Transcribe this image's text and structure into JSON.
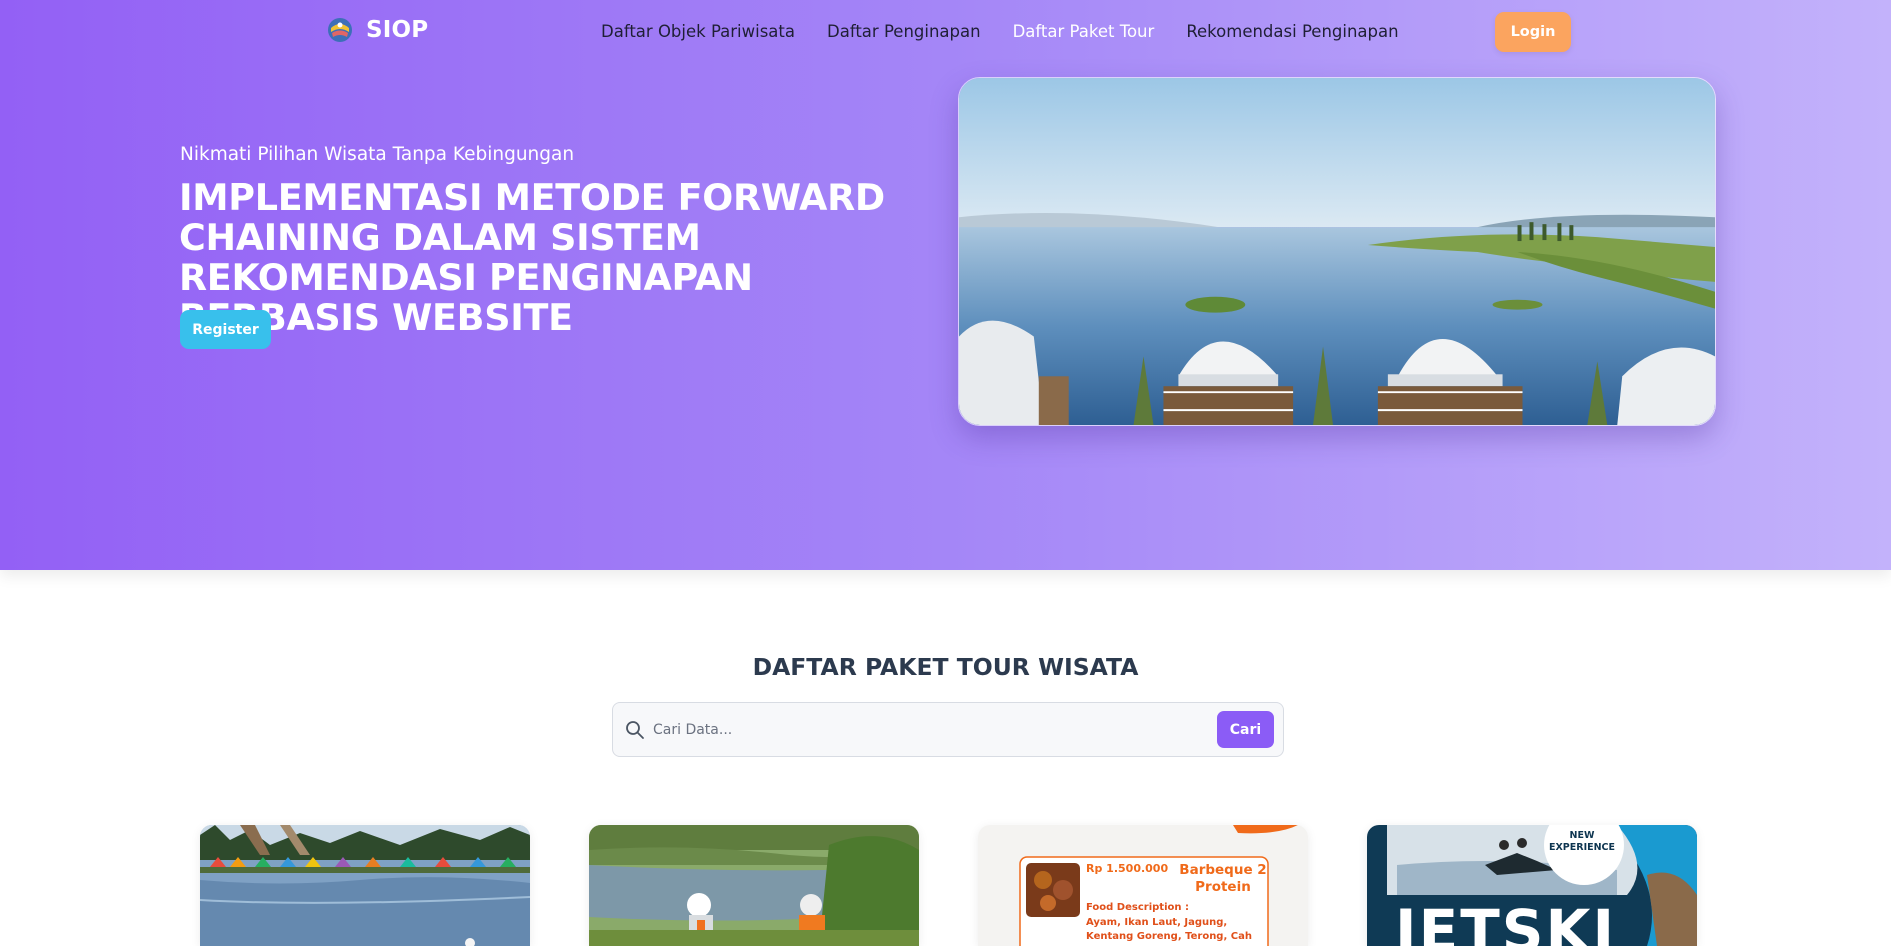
{
  "navbar": {
    "brand": "SIOP",
    "links": [
      {
        "label": "Daftar Objek Pariwisata",
        "active": false
      },
      {
        "label": "Daftar Penginapan",
        "active": false
      },
      {
        "label": "Daftar Paket Tour",
        "active": true
      },
      {
        "label": "Rekomendasi Penginapan",
        "active": false
      }
    ],
    "login_label": "Login"
  },
  "hero": {
    "subtitle": "Nikmati Pilihan Wisata Tanpa Kebingungan",
    "title": "IMPLEMENTASI METODE FORWARD CHAINING DALAM SISTEM REKOMENDASI PENGINAPAN BERBASIS WEBSITE",
    "register_label": "Register"
  },
  "section": {
    "title": "DAFTAR PAKET TOUR WISATA",
    "search_placeholder": "Cari Data...",
    "search_value": "",
    "search_button": "Cari"
  },
  "cards": [
    {
      "image": "lake-camping-tents"
    },
    {
      "image": "cycling-by-lake"
    },
    {
      "image": "barbeque-poster",
      "price": "Rp 1.500.000",
      "title": "Barbeque 2 Protein",
      "desc_label": "Food Description :",
      "desc": "Ayam, Ikan Laut, Jagung, Kentang Goreng, Terong, Cah"
    },
    {
      "image": "jetski-poster",
      "badge": "NEW EXPERIENCE",
      "headline": "JETSKI"
    }
  ],
  "colors": {
    "hero_gradient_start": "#9360f5",
    "hero_gradient_end": "#c3b2fb",
    "login_button": "#fba45f",
    "register_button": "#38c0ec",
    "search_button": "#8b5cf6",
    "section_title": "#2c3a4e"
  },
  "icons": {
    "brand_logo": "siop-logo-icon",
    "search": "search-icon"
  }
}
